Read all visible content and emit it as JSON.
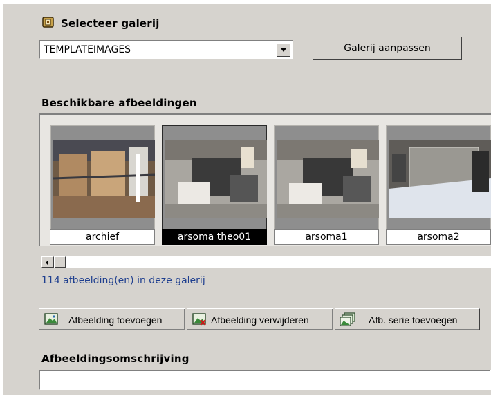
{
  "gallery_select": {
    "heading": "Selecteer galerij",
    "selected_value": "TEMPLATEIMAGES",
    "edit_button_label": "Galerij aanpassen"
  },
  "available_images": {
    "heading": "Beschikbare afbeeldingen",
    "thumbnails": [
      {
        "caption": "archief",
        "selected": false
      },
      {
        "caption": "arsoma theo01",
        "selected": true
      },
      {
        "caption": "arsoma1",
        "selected": false
      },
      {
        "caption": "arsoma2",
        "selected": false
      }
    ],
    "count_text": "114 afbeelding(en) in deze galerij"
  },
  "actions": {
    "add_image": "Afbeelding toevoegen",
    "remove_image": "Afbeelding verwijderen",
    "add_series": "Afb. serie toevoegen"
  },
  "description": {
    "heading": "Afbeeldingsomschrijving",
    "value": ""
  },
  "icons": {
    "gallery": "gallery-icon",
    "add": "add-image-icon",
    "remove": "remove-image-icon",
    "series": "image-series-icon"
  }
}
